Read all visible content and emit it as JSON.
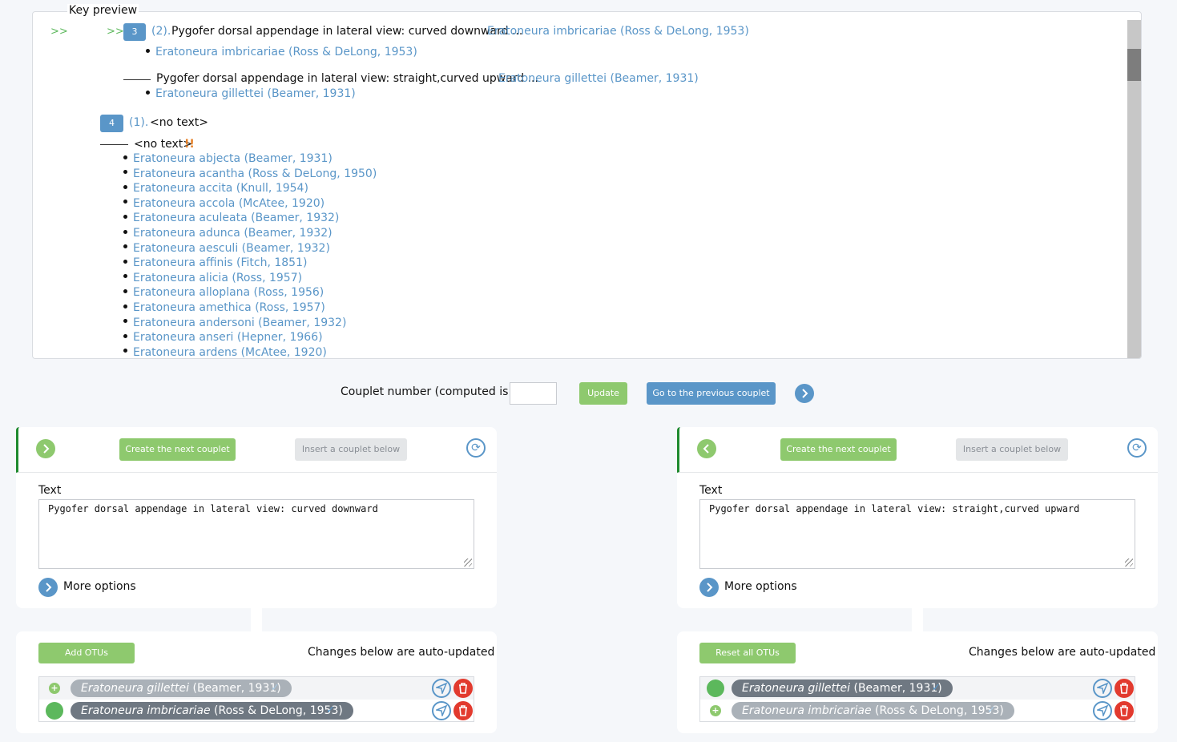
{
  "preview": {
    "legend": "Key preview",
    "couplet3": {
      "marker_outer": ">>",
      "marker_inner": ">>",
      "number": "3",
      "parent": "(2).",
      "lead1_text": "Pygofer dorsal appendage in lateral view: curved downward ...",
      "lead1_otu": "Eratoneura imbricariae (Ross & DeLong, 1953)",
      "lead1_bullet": "Eratoneura imbricariae (Ross & DeLong, 1953)",
      "lead2_text": "Pygofer dorsal appendage in lateral view: straight,curved upward ...",
      "lead2_otu": "Eratoneura gillettei (Beamer, 1931)",
      "lead2_bullet": "Eratoneura gillettei (Beamer, 1931)"
    },
    "couplet4": {
      "number": "4",
      "parent": "(1).",
      "lead1_text": "<no text>",
      "lead2_text": "<no text>",
      "warning": "!!",
      "otus": [
        "Eratoneura abjecta (Beamer, 1931)",
        "Eratoneura acantha (Ross & DeLong, 1950)",
        "Eratoneura accita (Knull, 1954)",
        "Eratoneura accola (McAtee, 1920)",
        "Eratoneura aculeata (Beamer, 1932)",
        "Eratoneura adunca (Beamer, 1932)",
        "Eratoneura aesculi (Beamer, 1932)",
        "Eratoneura affinis (Fitch, 1851)",
        "Eratoneura alicia (Ross, 1957)",
        "Eratoneura alloplana (Ross, 1956)",
        "Eratoneura amethica (Ross, 1957)",
        "Eratoneura andersoni (Beamer, 1932)",
        "Eratoneura anseri (Hepner, 1966)",
        "Eratoneura ardens (McAtee, 1920)"
      ]
    }
  },
  "couplet_row": {
    "label": "Couplet number (computed is 3):",
    "input_value": "",
    "update_label": "Update",
    "previous_label": "Go to the previous couplet"
  },
  "left_lead": {
    "create_label": "Create the next couplet",
    "insert_label": "Insert a couplet below",
    "text_label": "Text",
    "text_value": "Pygofer dorsal appendage in lateral view: curved downward",
    "more_options": "More options",
    "otus_button": "Add OTUs",
    "auto_updated": "Changes below are auto-updated",
    "otus": [
      {
        "genus_species": "Eratoneura gillettei",
        "author": "(Beamer, 1931)"
      },
      {
        "genus_species": "Eratoneura imbricariae",
        "author": "(Ross & DeLong, 1953)"
      }
    ]
  },
  "right_lead": {
    "create_label": "Create the next couplet",
    "insert_label": "Insert a couplet below",
    "text_label": "Text",
    "text_value": "Pygofer dorsal appendage in lateral view: straight,curved upward",
    "more_options": "More options",
    "otus_button": "Reset all OTUs",
    "auto_updated": "Changes below are auto-updated",
    "otus": [
      {
        "genus_species": "Eratoneura gillettei",
        "author": "(Beamer, 1931)"
      },
      {
        "genus_species": "Eratoneura imbricariae",
        "author": "(Ross & DeLong, 1953)"
      }
    ]
  },
  "glyphs": {
    "check": "✓",
    "plus": "+"
  },
  "colors": {
    "accent_blue": "#5a96c8",
    "accent_green": "#8ec96e",
    "status_green": "#5cb85c",
    "delete_red": "#e23a2e",
    "border_green": "#1f8a2f"
  }
}
